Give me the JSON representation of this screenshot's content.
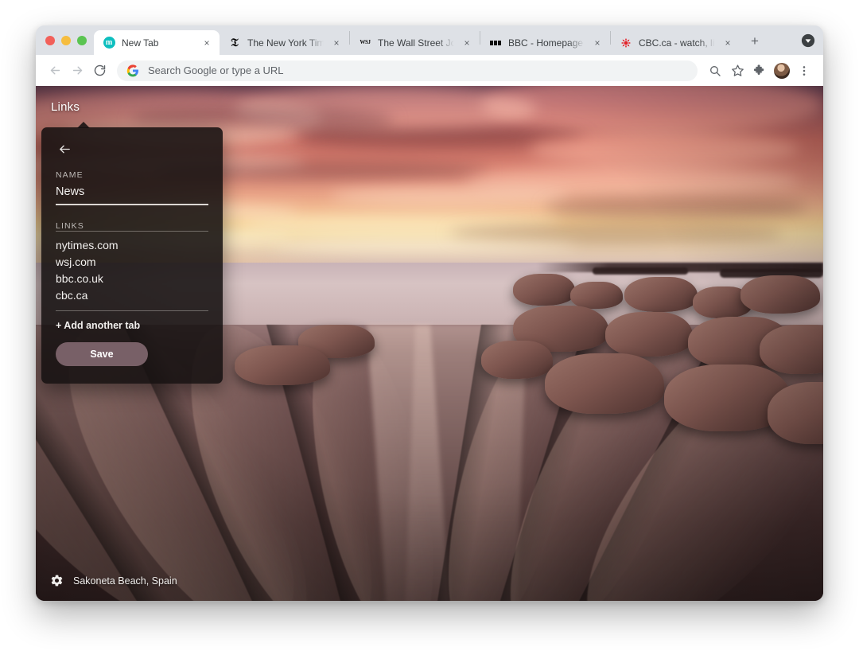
{
  "window": {
    "traffic_lights": [
      "close",
      "minimize",
      "zoom"
    ]
  },
  "tabs": [
    {
      "title": "New Tab",
      "favicon": "momentum-icon",
      "active": true,
      "close_label": "×"
    },
    {
      "title": "The New York Times - B",
      "favicon": "nytimes-icon",
      "active": false,
      "close_label": "×"
    },
    {
      "title": "The Wall Street Journal",
      "favicon": "wsj-icon",
      "active": false,
      "close_label": "×"
    },
    {
      "title": "BBC - Homepage",
      "favicon": "bbc-icon",
      "active": false,
      "close_label": "×"
    },
    {
      "title": "CBC.ca - watch, listen, ",
      "favicon": "cbc-icon",
      "active": false,
      "close_label": "×"
    }
  ],
  "tabstrip": {
    "new_tab_label": "+",
    "tab_search_name": "tab-search-icon"
  },
  "toolbar": {
    "back_name": "back-arrow-icon",
    "forward_name": "forward-arrow-icon",
    "reload_name": "reload-icon",
    "omnibox_placeholder": "Search Google or type a URL",
    "search_icon": "zoom-search-icon",
    "bookmark_icon": "star-icon",
    "extensions_icon": "puzzle-icon",
    "profile_icon": "avatar",
    "menu_icon": "three-dot-menu-icon"
  },
  "newtab": {
    "links_heading": "Links",
    "attribution": "Sakoneta Beach, Spain",
    "settings_icon": "gear-icon"
  },
  "edit_panel": {
    "back_icon": "back-arrow-icon",
    "name_label": "NAME",
    "name_value": "News",
    "links_label": "LINKS",
    "links": [
      "nytimes.com",
      "wsj.com",
      "bbc.co.uk",
      "cbc.ca"
    ],
    "add_link_label": "+ Add another tab",
    "save_label": "Save"
  },
  "colors": {
    "panel_bg": "#141010",
    "save_button": "#786067",
    "tabstrip_bg": "#dee1e6",
    "toolbar_bg": "#ffffff",
    "omnibox_bg": "#f1f3f4",
    "momentum_teal": "#0ebfbf",
    "cbc_red": "#e3242b"
  }
}
